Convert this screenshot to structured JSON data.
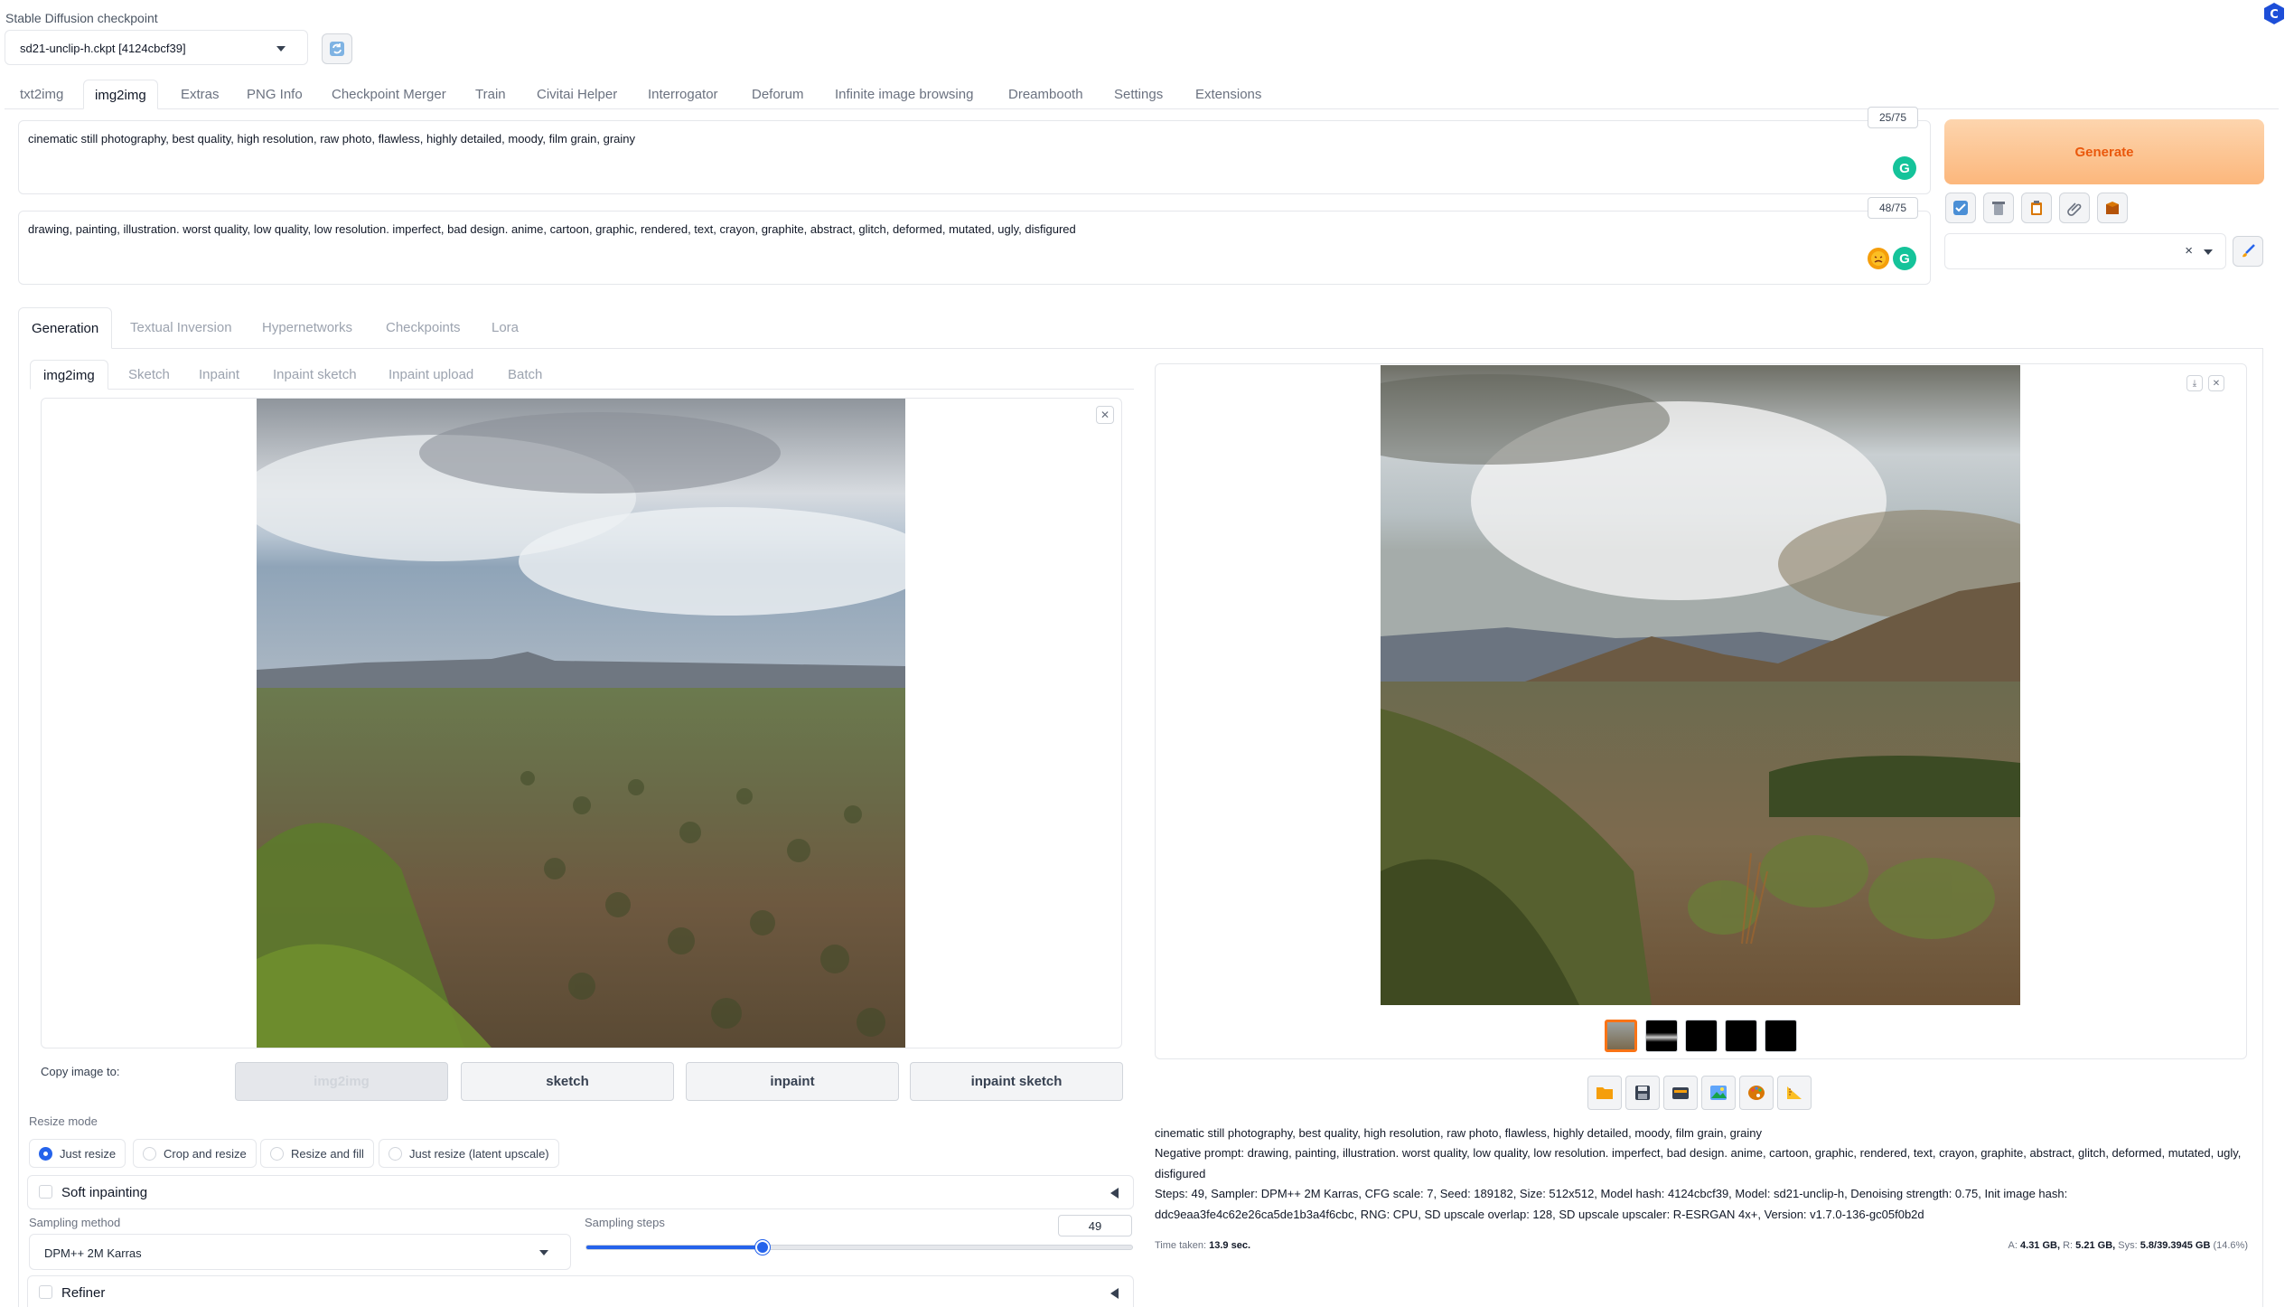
{
  "checkpoint": {
    "label": "Stable Diffusion checkpoint",
    "value": "sd21-unclip-h.ckpt [4124cbcf39]"
  },
  "tabs": [
    "txt2img",
    "img2img",
    "Extras",
    "PNG Info",
    "Checkpoint Merger",
    "Train",
    "Civitai Helper",
    "Interrogator",
    "Deforum",
    "Infinite image browsing",
    "Dreambooth",
    "Settings",
    "Extensions"
  ],
  "active_tab": "img2img",
  "prompt": {
    "text": "cinematic still photography, best quality, high resolution, raw photo, flawless, highly detailed, moody, film grain, grainy",
    "counter": "25/75"
  },
  "negative_prompt": {
    "text": "drawing, painting, illustration. worst quality, low quality, low resolution. imperfect, bad design. anime, cartoon, graphic, rendered, text, crayon, graphite, abstract, glitch, deformed, mutated, ugly, disfigured",
    "counter": "48/75"
  },
  "generate_label": "Generate",
  "tool_buttons": [
    "checkbox-icon",
    "trash-icon",
    "clipboard-icon",
    "paperclip-icon",
    "box-icon"
  ],
  "style_select": {
    "clear": "×"
  },
  "gen_tabs": [
    "Generation",
    "Textual Inversion",
    "Hypernetworks",
    "Checkpoints",
    "Lora"
  ],
  "img_tabs": [
    "img2img",
    "Sketch",
    "Inpaint",
    "Inpaint sketch",
    "Inpaint upload",
    "Batch"
  ],
  "copy_image": {
    "label": "Copy image to:",
    "buttons": [
      "img2img",
      "sketch",
      "inpaint",
      "inpaint sketch"
    ]
  },
  "resize_mode": {
    "label": "Resize mode",
    "options": [
      "Just resize",
      "Crop and resize",
      "Resize and fill",
      "Just resize (latent upscale)"
    ],
    "selected": "Just resize"
  },
  "soft_inpainting": "Soft inpainting",
  "sampling": {
    "method_label": "Sampling method",
    "method_value": "DPM++ 2M Karras",
    "steps_label": "Sampling steps",
    "steps_value": "49",
    "steps_min": 1,
    "steps_max": 150
  },
  "refiner": "Refiner",
  "output": {
    "thumbnails": 5,
    "tools": [
      "folder-icon",
      "save-icon",
      "zip-icon",
      "image-icon",
      "palette-icon",
      "ruler-icon"
    ],
    "info_prompt": "cinematic still photography, best quality, high resolution, raw photo, flawless, highly detailed, moody, film grain, grainy",
    "info_negative": "Negative prompt: drawing, painting, illustration. worst quality, low quality, low resolution. imperfect, bad design. anime, cartoon, graphic, rendered, text, crayon, graphite, abstract, glitch, deformed, mutated, ugly, disfigured",
    "info_params": "Steps: 49, Sampler: DPM++ 2M Karras, CFG scale: 7, Seed: 189182, Size: 512x512, Model hash: 4124cbcf39, Model: sd21-unclip-h, Denoising strength: 0.75, Init image hash: ddc9eaa3fe4c62e26ca5de1b3a4f6cbc, RNG: CPU, SD upscale overlap: 128, SD upscale upscaler: R-ESRGAN 4x+, Version: v1.7.0-136-gc05f0b2d",
    "time_label": "Time taken:",
    "time_value": "13.9 sec.",
    "vram_a_label": "A:",
    "vram_a": "4.31 GB,",
    "vram_r_label": "R:",
    "vram_r": "5.21 GB,",
    "vram_sys_label": "Sys:",
    "vram_sys": "5.8/39.3945 GB",
    "vram_pct": "(14.6%)"
  },
  "colors": {
    "accent": "#2563eb",
    "generate_text": "#ea580c",
    "generate_bg": "#fcc28f",
    "grammarly": "#15c39a"
  }
}
